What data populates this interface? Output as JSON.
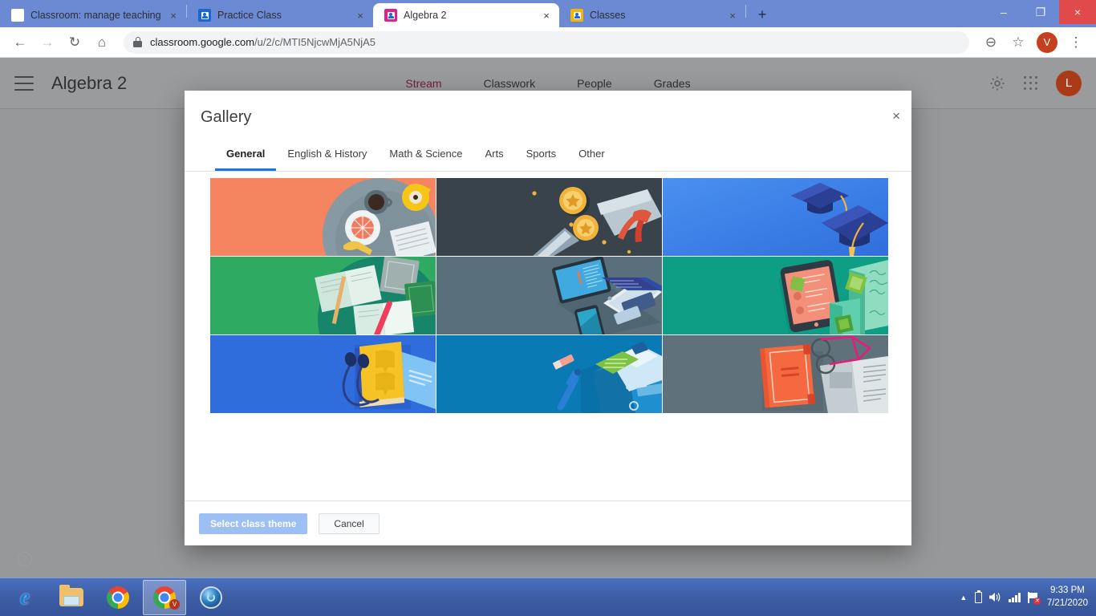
{
  "browser": {
    "tabs": [
      {
        "title": "Classroom: manage teaching and",
        "favicon": "google-icon",
        "active": false,
        "close_label": "×"
      },
      {
        "title": "Practice Class",
        "favicon": "classroom-icon-blue",
        "active": false,
        "close_label": "×"
      },
      {
        "title": "Algebra 2",
        "favicon": "classroom-icon-pink",
        "active": true,
        "close_label": "×"
      },
      {
        "title": "Classes",
        "favicon": "classroom-icon-green",
        "active": false,
        "close_label": "×"
      }
    ],
    "new_tab_label": "+",
    "window_controls": {
      "minimize": "–",
      "maximize": "❐",
      "close": "×"
    },
    "toolbar": {
      "back": "←",
      "forward": "→",
      "reload": "↻",
      "home": "⌂",
      "url_host": "classroom.google.com",
      "url_path": "/u/2/c/MTI5NjcwMjA5NjA5",
      "zoom_icon": "⊖",
      "bookmark_icon": "☆",
      "profile_initial": "V",
      "menu_icon": "⋮"
    }
  },
  "classroom": {
    "title": "Algebra 2",
    "nav": [
      {
        "label": "Stream",
        "active": true
      },
      {
        "label": "Classwork",
        "active": false
      },
      {
        "label": "People",
        "active": false
      },
      {
        "label": "Grades",
        "active": false
      }
    ],
    "settings_icon": "gear-icon",
    "apps_icon": "apps-grid-icon",
    "account_initial": "L",
    "help_label": "?"
  },
  "modal": {
    "title": "Gallery",
    "close_label": "×",
    "tabs": [
      {
        "label": "General",
        "active": true
      },
      {
        "label": "English & History",
        "active": false
      },
      {
        "label": "Math & Science",
        "active": false
      },
      {
        "label": "Arts",
        "active": false
      },
      {
        "label": "Sports",
        "active": false
      },
      {
        "label": "Other",
        "active": false
      }
    ],
    "themes": [
      {
        "name": "breakfast-table",
        "bg": "#f58560",
        "accent": "#7d97a3"
      },
      {
        "name": "medals-diploma",
        "bg": "#39434b",
        "accent": "#f0b43c"
      },
      {
        "name": "graduation-caps",
        "bg": "#3b82f6",
        "accent": "#2b3f94"
      },
      {
        "name": "books-desk-green",
        "bg": "#2eaa63",
        "accent": "#16856a"
      },
      {
        "name": "laptop-tablet-phone",
        "bg": "#59707c",
        "accent": "#2b4ea8"
      },
      {
        "name": "phone-notes-teal",
        "bg": "#0d9e85",
        "accent": "#f47f64"
      },
      {
        "name": "book-earbuds-blue",
        "bg": "#2f6ddd",
        "accent": "#f7c325"
      },
      {
        "name": "backpack-supplies",
        "bg": "#0a7ab5",
        "accent": "#8cc63f"
      },
      {
        "name": "book-glasses-news",
        "bg": "#5f727b",
        "accent": "#f4623a"
      }
    ],
    "primary_button": "Select class theme",
    "secondary_button": "Cancel"
  },
  "taskbar": {
    "items": [
      {
        "name": "internet-explorer",
        "active": false
      },
      {
        "name": "file-explorer",
        "active": false
      },
      {
        "name": "google-chrome",
        "active": false
      },
      {
        "name": "google-chrome-window",
        "active": true,
        "badge": "V"
      },
      {
        "name": "media-app",
        "active": false
      }
    ],
    "tray": {
      "show_hidden": "▲",
      "battery_icon": "battery-icon",
      "volume_icon": "🔊",
      "network_icon": "signal-bars-icon",
      "action_center_icon": "flag-icon",
      "time": "9:33 PM",
      "date": "7/21/2020"
    }
  }
}
